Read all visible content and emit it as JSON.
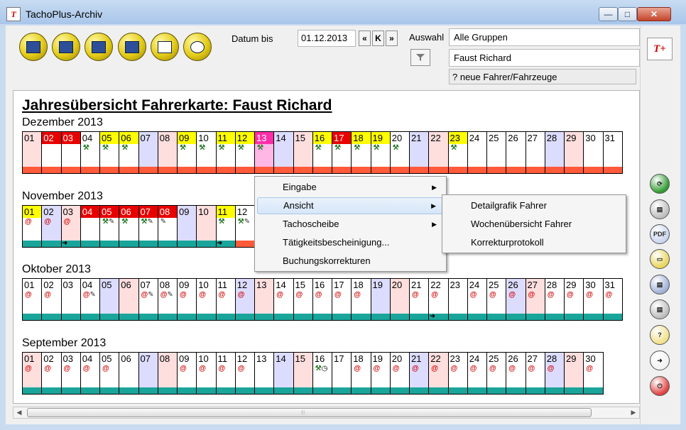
{
  "window": {
    "title": "TachoPlus-Archiv",
    "min": "—",
    "max": "□",
    "close": "✕"
  },
  "toolbar": {
    "datum_bis_label": "Datum bis",
    "date_value": "01.12.2013",
    "nav_prev": "«",
    "nav_k": "K",
    "nav_next": "»",
    "auswahl_label": "Auswahl",
    "group_value": "Alle Gruppen",
    "driver_value": "Faust Richard",
    "info_value": "? neue Fahrer/Fahrzeuge",
    "buttons": [
      "driver-card-button",
      "drivers-button",
      "vehicle-card-button",
      "vehicles-button",
      "checklist-button",
      "search-document-button"
    ]
  },
  "sidebar": {
    "logo": "T+",
    "buttons": [
      {
        "name": "sync-button",
        "glyph": "⟳",
        "color": "#2e9a2e"
      },
      {
        "name": "print-button",
        "glyph": "▤",
        "color": "#bdbdbd"
      },
      {
        "name": "pdf-button",
        "glyph": "PDF",
        "color": "#c9d5ef"
      },
      {
        "name": "open-folder-button",
        "glyph": "▭",
        "color": "#e8d55a"
      },
      {
        "name": "print-preview-button",
        "glyph": "▤",
        "color": "#9fb0d6"
      },
      {
        "name": "printer-button",
        "glyph": "▤",
        "color": "#bdbdbd"
      },
      {
        "name": "help-button",
        "glyph": "?",
        "color": "#f0e08a"
      },
      {
        "name": "export-button",
        "glyph": "➜",
        "color": "#f1f1f1"
      },
      {
        "name": "power-button",
        "glyph": "⏻",
        "color": "#e04040"
      }
    ]
  },
  "main": {
    "heading": "Jahresübersicht Fahrerkarte: Faust Richard",
    "months": [
      {
        "label": "Dezember 2013",
        "days": [
          {
            "n": "01",
            "c": "pink",
            "bar": "orange"
          },
          {
            "n": "02",
            "c": "red",
            "bar": "orange"
          },
          {
            "n": "03",
            "c": "red",
            "bar": "orange"
          },
          {
            "n": "04",
            "s": [
              "hammer"
            ],
            "bar": "orange"
          },
          {
            "n": "05",
            "c": "yellow",
            "s": [
              "hammer"
            ],
            "bar": "orange"
          },
          {
            "n": "06",
            "c": "yellow",
            "s": [
              "hammer"
            ],
            "bar": "orange"
          },
          {
            "n": "07",
            "c": "lav",
            "bar": "orange"
          },
          {
            "n": "08",
            "c": "pink",
            "bar": "orange"
          },
          {
            "n": "09",
            "c": "yellow",
            "s": [
              "hammer"
            ],
            "bar": "orange"
          },
          {
            "n": "10",
            "s": [
              "hammer"
            ],
            "bar": "orange"
          },
          {
            "n": "11",
            "c": "yellow",
            "s": [
              "hammer"
            ],
            "bar": "orange"
          },
          {
            "n": "12",
            "c": "yellow",
            "s": [
              "hammer"
            ],
            "bar": "orange"
          },
          {
            "n": "13",
            "c": "mag",
            "s": [
              "hammer"
            ],
            "bar": "orange"
          },
          {
            "n": "14",
            "c": "lav",
            "bar": "orange"
          },
          {
            "n": "15",
            "c": "pink",
            "bar": "orange"
          },
          {
            "n": "16",
            "c": "yellow",
            "s": [
              "hammer"
            ],
            "bar": "orange"
          },
          {
            "n": "17",
            "c": "red",
            "s": [
              "hammer"
            ],
            "bar": "orange"
          },
          {
            "n": "18",
            "c": "yellow",
            "s": [
              "hammer"
            ],
            "bar": "orange"
          },
          {
            "n": "19",
            "c": "yellow",
            "s": [
              "hammer"
            ],
            "bar": "orange"
          },
          {
            "n": "20",
            "s": [
              "hammer"
            ],
            "bar": "orange"
          },
          {
            "n": "21",
            "c": "lav",
            "bar": "orange"
          },
          {
            "n": "22",
            "c": "pink",
            "bar": "orange"
          },
          {
            "n": "23",
            "c": "yellow",
            "s": [
              "hammer"
            ],
            "bar": "orange"
          },
          {
            "n": "24",
            "bar": "orange"
          },
          {
            "n": "25",
            "bar": "orange"
          },
          {
            "n": "26",
            "bar": "orange"
          },
          {
            "n": "27",
            "bar": "orange"
          },
          {
            "n": "28",
            "c": "lav",
            "bar": "orange"
          },
          {
            "n": "29",
            "c": "pink",
            "bar": "orange"
          },
          {
            "n": "30",
            "bar": "orange"
          },
          {
            "n": "31",
            "bar": "orange"
          }
        ]
      },
      {
        "label": "November 2013",
        "days": [
          {
            "n": "01",
            "c": "yellow",
            "s": [
              "at"
            ],
            "bar": "teal"
          },
          {
            "n": "02",
            "c": "lav",
            "s": [
              "at"
            ],
            "bar": "teal"
          },
          {
            "n": "03",
            "c": "pink",
            "s": [
              "at"
            ],
            "bar": "teal",
            "arrow": true
          },
          {
            "n": "04",
            "c": "red",
            "bar": "teal"
          },
          {
            "n": "05",
            "c": "red",
            "s": [
              "hammer",
              "pen"
            ],
            "bar": "teal"
          },
          {
            "n": "06",
            "c": "red",
            "s": [
              "hammer"
            ],
            "bar": "teal"
          },
          {
            "n": "07",
            "c": "red",
            "s": [
              "hammer",
              "pen"
            ],
            "bar": "teal"
          },
          {
            "n": "08",
            "c": "red",
            "s": [
              "pen"
            ],
            "bar": "teal"
          },
          {
            "n": "09",
            "c": "lav",
            "bar": "teal"
          },
          {
            "n": "10",
            "c": "pink",
            "bar": "teal"
          },
          {
            "n": "11",
            "c": "yellow",
            "s": [
              "hammer"
            ],
            "bar": "teal",
            "arrow": true
          },
          {
            "n": "12",
            "s": [
              "hammer",
              "pen"
            ],
            "bar": "orange"
          }
        ]
      },
      {
        "label": "Oktober 2013",
        "days": [
          {
            "n": "01",
            "s": [
              "at"
            ],
            "bar": "teal"
          },
          {
            "n": "02",
            "s": [
              "at"
            ],
            "bar": "teal"
          },
          {
            "n": "03",
            "bar": "teal"
          },
          {
            "n": "04",
            "s": [
              "at",
              "pen"
            ],
            "bar": "teal"
          },
          {
            "n": "05",
            "c": "lav",
            "bar": "teal"
          },
          {
            "n": "06",
            "c": "pink",
            "bar": "teal"
          },
          {
            "n": "07",
            "s": [
              "at",
              "pen"
            ],
            "bar": "teal"
          },
          {
            "n": "08",
            "s": [
              "at",
              "pen"
            ],
            "bar": "teal"
          },
          {
            "n": "09",
            "s": [
              "at"
            ],
            "bar": "teal"
          },
          {
            "n": "10",
            "s": [
              "at"
            ],
            "bar": "teal"
          },
          {
            "n": "11",
            "s": [
              "at"
            ],
            "bar": "teal"
          },
          {
            "n": "12",
            "c": "lav",
            "s": [
              "at"
            ],
            "bar": "teal"
          },
          {
            "n": "13",
            "c": "pink",
            "bar": "teal"
          },
          {
            "n": "14",
            "s": [
              "at"
            ],
            "bar": "teal"
          },
          {
            "n": "15",
            "s": [
              "at"
            ],
            "bar": "teal"
          },
          {
            "n": "16",
            "s": [
              "at"
            ],
            "bar": "teal"
          },
          {
            "n": "17",
            "s": [
              "at"
            ],
            "bar": "teal"
          },
          {
            "n": "18",
            "s": [
              "at"
            ],
            "bar": "teal"
          },
          {
            "n": "19",
            "c": "lav",
            "bar": "teal"
          },
          {
            "n": "20",
            "c": "pink",
            "bar": "teal"
          },
          {
            "n": "21",
            "s": [
              "at"
            ],
            "bar": "teal"
          },
          {
            "n": "22",
            "s": [
              "at"
            ],
            "bar": "teal",
            "arrow": true
          },
          {
            "n": "23",
            "bar": "teal"
          },
          {
            "n": "24",
            "s": [
              "at"
            ],
            "bar": "teal"
          },
          {
            "n": "25",
            "s": [
              "at"
            ],
            "bar": "teal"
          },
          {
            "n": "26",
            "c": "lav",
            "s": [
              "at"
            ],
            "bar": "teal"
          },
          {
            "n": "27",
            "c": "pink",
            "s": [
              "at"
            ],
            "bar": "teal"
          },
          {
            "n": "28",
            "s": [
              "at"
            ],
            "bar": "teal"
          },
          {
            "n": "29",
            "s": [
              "at"
            ],
            "bar": "teal"
          },
          {
            "n": "30",
            "s": [
              "at"
            ],
            "bar": "teal"
          },
          {
            "n": "31",
            "s": [
              "at"
            ],
            "bar": "teal"
          }
        ]
      },
      {
        "label": "September 2013",
        "days": [
          {
            "n": "01",
            "c": "pink",
            "s": [
              "at"
            ],
            "bar": "teal"
          },
          {
            "n": "02",
            "s": [
              "at"
            ],
            "bar": "teal"
          },
          {
            "n": "03",
            "s": [
              "at"
            ],
            "bar": "teal"
          },
          {
            "n": "04",
            "s": [
              "at"
            ],
            "bar": "teal"
          },
          {
            "n": "05",
            "s": [
              "at"
            ],
            "bar": "teal"
          },
          {
            "n": "06",
            "bar": "teal"
          },
          {
            "n": "07",
            "c": "lav",
            "bar": "teal"
          },
          {
            "n": "08",
            "c": "pink",
            "bar": "teal"
          },
          {
            "n": "09",
            "s": [
              "at"
            ],
            "bar": "teal"
          },
          {
            "n": "10",
            "s": [
              "at"
            ],
            "bar": "teal"
          },
          {
            "n": "11",
            "s": [
              "at"
            ],
            "bar": "teal"
          },
          {
            "n": "12",
            "s": [
              "at"
            ],
            "bar": "teal"
          },
          {
            "n": "13",
            "bar": "teal"
          },
          {
            "n": "14",
            "c": "lav",
            "bar": "teal"
          },
          {
            "n": "15",
            "c": "pink",
            "bar": "teal"
          },
          {
            "n": "16",
            "s": [
              "hammer",
              "clock"
            ],
            "bar": "teal"
          },
          {
            "n": "17",
            "bar": "teal"
          },
          {
            "n": "18",
            "s": [
              "at"
            ],
            "bar": "teal"
          },
          {
            "n": "19",
            "s": [
              "at"
            ],
            "bar": "teal"
          },
          {
            "n": "20",
            "s": [
              "at"
            ],
            "bar": "teal"
          },
          {
            "n": "21",
            "c": "lav",
            "s": [
              "at"
            ],
            "bar": "teal"
          },
          {
            "n": "22",
            "c": "pink",
            "s": [
              "at"
            ],
            "bar": "teal"
          },
          {
            "n": "23",
            "s": [
              "at"
            ],
            "bar": "teal"
          },
          {
            "n": "24",
            "s": [
              "at"
            ],
            "bar": "teal"
          },
          {
            "n": "25",
            "s": [
              "at"
            ],
            "bar": "teal"
          },
          {
            "n": "26",
            "s": [
              "at"
            ],
            "bar": "teal"
          },
          {
            "n": "27",
            "s": [
              "at"
            ],
            "bar": "teal"
          },
          {
            "n": "28",
            "c": "lav",
            "s": [
              "at"
            ],
            "bar": "teal"
          },
          {
            "n": "29",
            "c": "pink",
            "bar": "teal"
          },
          {
            "n": "30",
            "s": [
              "at"
            ],
            "bar": "teal"
          }
        ]
      }
    ]
  },
  "context_menu": {
    "items": [
      {
        "label": "Eingabe",
        "submenu": true,
        "highlighted": false
      },
      {
        "label": "Ansicht",
        "submenu": true,
        "highlighted": true
      },
      {
        "label": "Tachoscheibe",
        "submenu": true,
        "highlighted": false
      },
      {
        "label": "Tätigkeitsbescheinigung...",
        "submenu": false,
        "highlighted": false
      },
      {
        "label": "Buchungskorrekturen",
        "submenu": false,
        "highlighted": false
      }
    ],
    "chevron": "▶"
  },
  "submenu": {
    "items": [
      {
        "label": "Detailgrafik Fahrer"
      },
      {
        "label": "Wochenübersicht Fahrer"
      },
      {
        "label": "Korrekturprotokoll"
      }
    ]
  },
  "scrollbar": {
    "left_arrow": "◀",
    "right_arrow": "▶",
    "grip": "⦙⦙⦙"
  },
  "colors": {
    "orange_bar": "#ff5a3a",
    "teal_bar": "#1aa59b"
  }
}
